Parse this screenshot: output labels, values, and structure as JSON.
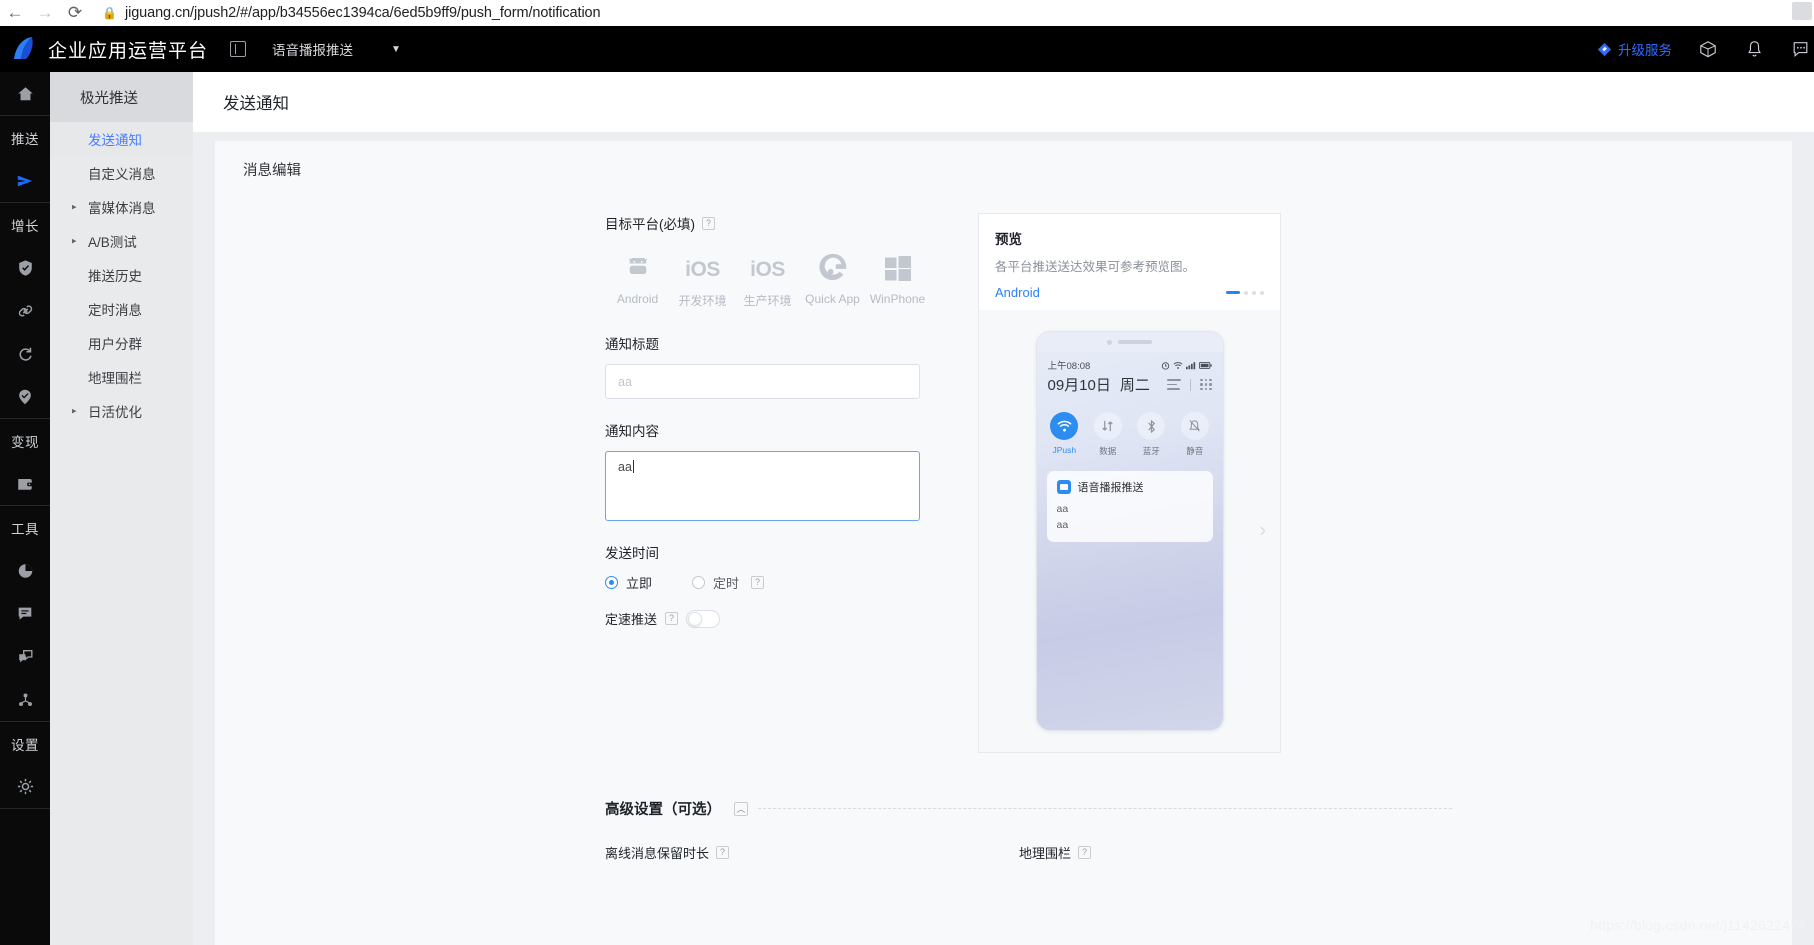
{
  "browser": {
    "url": "jiguang.cn/jpush2/#/app/b34556ec1394ca/6ed5b9ff9/push_form/notification",
    "back_icon": "back-arrow-icon",
    "forward_icon": "forward-arrow-icon",
    "reload_icon": "reload-icon",
    "lock_icon": "lock-icon"
  },
  "appbar": {
    "title": "企业应用运营平台",
    "app_selector": "语音播报推送",
    "caret": "▼",
    "upgrade_label": "升级服务",
    "icons": [
      "diamond-icon",
      "cube-icon",
      "bell-icon",
      "chat-icon"
    ]
  },
  "rail": {
    "groups": [
      {
        "items": [
          {
            "type": "icon",
            "name": "home-icon",
            "glyph": "⌂"
          }
        ]
      },
      {
        "items": [
          {
            "type": "label",
            "name": "rail-label-push",
            "label": "推送"
          },
          {
            "type": "icon",
            "name": "send-icon",
            "glyph": "➤",
            "active": true
          }
        ]
      },
      {
        "items": [
          {
            "type": "label",
            "name": "rail-label-growth",
            "label": "增长"
          },
          {
            "type": "icon",
            "name": "shield-icon",
            "glyph": "⛊"
          },
          {
            "type": "icon",
            "name": "link-icon",
            "glyph": "⧉"
          },
          {
            "type": "icon",
            "name": "refresh-icon",
            "glyph": "↻"
          },
          {
            "type": "icon",
            "name": "pin-analytics-icon",
            "glyph": "◈"
          }
        ]
      },
      {
        "items": [
          {
            "type": "label",
            "name": "rail-label-monetize",
            "label": "变现"
          },
          {
            "type": "icon",
            "name": "wallet-icon",
            "glyph": "▤"
          }
        ]
      },
      {
        "items": [
          {
            "type": "label",
            "name": "rail-label-tools",
            "label": "工具"
          },
          {
            "type": "icon",
            "name": "pie-chart-icon",
            "glyph": "◓"
          },
          {
            "type": "icon",
            "name": "message-icon",
            "glyph": "▤"
          },
          {
            "type": "icon",
            "name": "chat-bubbles-icon",
            "glyph": "▣"
          },
          {
            "type": "icon",
            "name": "network-icon",
            "glyph": "⁂"
          }
        ]
      },
      {
        "items": [
          {
            "type": "label",
            "name": "rail-label-settings",
            "label": "设置"
          },
          {
            "type": "icon",
            "name": "gear-icon",
            "glyph": "✿"
          }
        ]
      }
    ]
  },
  "subnav": {
    "header": "极光推送",
    "items": [
      {
        "label": "发送通知",
        "active": true,
        "expandable": false
      },
      {
        "label": "自定义消息",
        "active": false,
        "expandable": false
      },
      {
        "label": "富媒体消息",
        "active": false,
        "expandable": true
      },
      {
        "label": "A/B测试",
        "active": false,
        "expandable": true
      },
      {
        "label": "推送历史",
        "active": false,
        "expandable": false
      },
      {
        "label": "定时消息",
        "active": false,
        "expandable": false
      },
      {
        "label": "用户分群",
        "active": false,
        "expandable": false
      },
      {
        "label": "地理围栏",
        "active": false,
        "expandable": false
      },
      {
        "label": "日活优化",
        "active": false,
        "expandable": true
      }
    ]
  },
  "page": {
    "title": "发送通知",
    "card_header": "消息编辑"
  },
  "form": {
    "platform_label": "目标平台(必填)",
    "platform_help": "?",
    "platforms": [
      {
        "name": "Android",
        "icon": "android-icon"
      },
      {
        "name": "开发环境",
        "icon": "ios-icon"
      },
      {
        "name": "生产环境",
        "icon": "ios-icon"
      },
      {
        "name": "Quick App",
        "icon": "quickapp-icon"
      },
      {
        "name": "WinPhone",
        "icon": "windows-icon"
      }
    ],
    "title_label": "通知标题",
    "title_value": "aa",
    "title_placeholder": "aa",
    "content_label": "通知内容",
    "content_value": "aa",
    "send_time_label": "发送时间",
    "radio_now": "立即",
    "radio_scheduled": "定时",
    "radio_help": "?",
    "rate_push_label": "定速推送",
    "rate_push_help": "?",
    "rate_push_on": false
  },
  "preview": {
    "title": "预览",
    "subtitle": "各平台推送送达效果可参考预览图。",
    "tab": "Android",
    "arrow": "›",
    "phone": {
      "time": "上午08:08",
      "date": "09月10日",
      "weekday": "周二",
      "toggles": [
        {
          "label": "JPush",
          "icon": "wifi-icon",
          "on": true
        },
        {
          "label": "数据",
          "icon": "data-icon",
          "on": false
        },
        {
          "label": "蓝牙",
          "icon": "bluetooth-icon",
          "on": false
        },
        {
          "label": "静音",
          "icon": "mute-bell-icon",
          "on": false
        }
      ],
      "notification": {
        "app_name": "语音播报推送",
        "line1": "aa",
        "line2": "aa"
      }
    }
  },
  "advanced": {
    "title": "高级设置（可选）",
    "collapse": "︿",
    "fields": [
      {
        "label": "离线消息保留时长",
        "help": "?"
      },
      {
        "label": "地理围栏",
        "help": "?"
      }
    ]
  },
  "watermark": "https://blog.csdn.net/j1142622474",
  "colors": {
    "accent": "#2d8cf0",
    "link": "#2d7ff9",
    "appbar_bg": "#000000",
    "page_bg": "#eceef1"
  }
}
